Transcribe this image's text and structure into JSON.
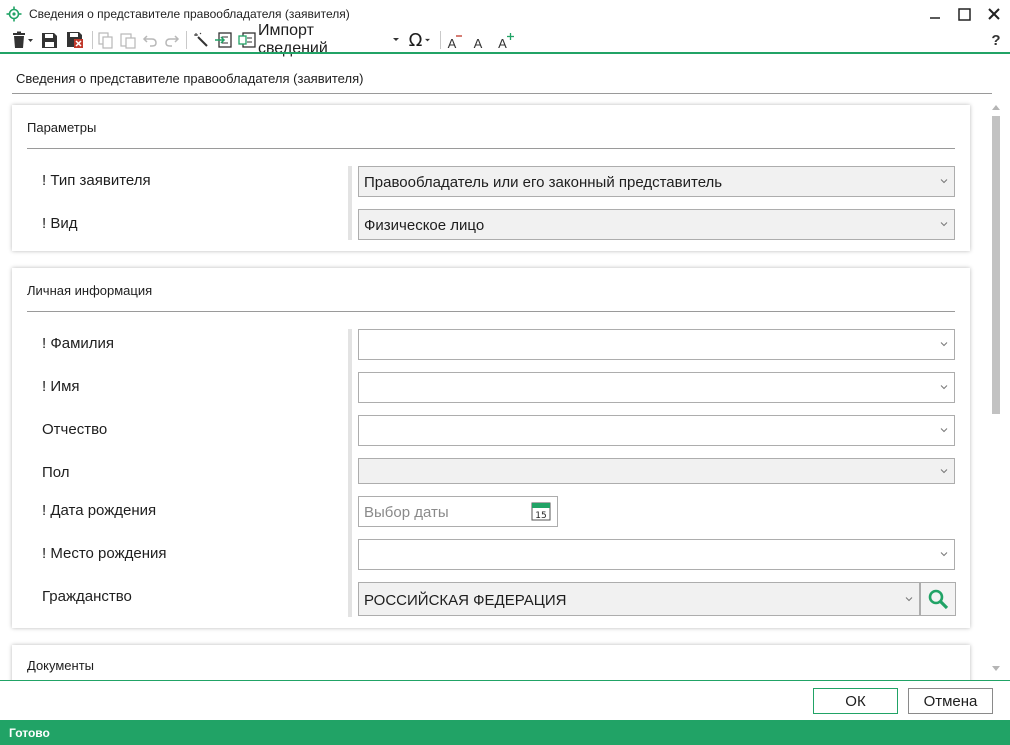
{
  "window": {
    "title": "Сведения о представителе правообладателя (заявителя)",
    "icon": "crosshair-gear-icon",
    "controls": [
      "minimize-icon",
      "maximize-icon",
      "close-icon"
    ]
  },
  "toolbar": {
    "import_label": "Импорт сведений",
    "omega_glyph": "Ω",
    "font_decrease_glyph": "A",
    "font_reset_glyph": "A",
    "font_increase_glyph": "A",
    "help_glyph": "?"
  },
  "page_title": "Сведения о представителе правообладателя (заявителя)",
  "sections": {
    "params": {
      "title": "Параметры",
      "applicant_type_label": "! Тип заявителя",
      "applicant_type_value": "Правообладатель или его законный представитель",
      "kind_label": "! Вид",
      "kind_value": "Физическое лицо"
    },
    "personal": {
      "title": "Личная информация",
      "surname_label": "! Фамилия",
      "surname_value": "",
      "name_label": "! Имя",
      "name_value": "",
      "patronymic_label": "Отчество",
      "patronymic_value": "",
      "gender_label": "Пол",
      "gender_value": "",
      "birth_date_label": "! Дата рождения",
      "birth_date_placeholder": "Выбор даты",
      "calendar_day": "15",
      "birth_place_label": "! Место рождения",
      "birth_place_value": "",
      "citizenship_label": "Гражданство",
      "citizenship_value": "РОССИЙСКАЯ ФЕДЕРАЦИЯ"
    },
    "documents": {
      "title": "Документы"
    }
  },
  "buttons": {
    "ok": "ОК",
    "cancel": "Отмена"
  },
  "status": "Готово",
  "colors": {
    "accent": "#21a366",
    "field_bg": "#f1f1f1",
    "border": "#adadad"
  }
}
